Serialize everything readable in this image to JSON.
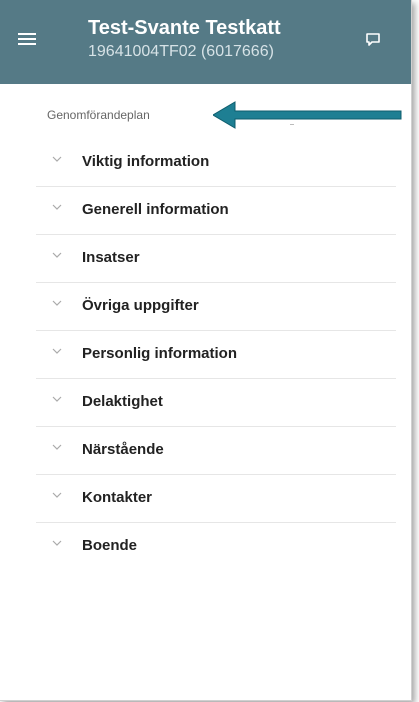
{
  "appbar": {
    "title": "Test-Svante Testkatt",
    "subtitle": "19641004TF02 (6017666)",
    "background_color": "#557a86",
    "menu_icon": "hamburger-menu-icon",
    "action_icon": "chat-bubble-icon"
  },
  "section": {
    "header": "Genomförandeplan"
  },
  "annotation": {
    "arrow_color": "#1e7f93",
    "icon": "arrow-left-icon"
  },
  "accordion": {
    "chevron_icon": "chevron-down-icon",
    "items": [
      {
        "label": "Viktig information"
      },
      {
        "label": "Generell information"
      },
      {
        "label": "Insatser"
      },
      {
        "label": "Övriga uppgifter"
      },
      {
        "label": "Personlig information"
      },
      {
        "label": "Delaktighet"
      },
      {
        "label": "Närstående"
      },
      {
        "label": "Kontakter"
      },
      {
        "label": "Boende"
      }
    ]
  }
}
